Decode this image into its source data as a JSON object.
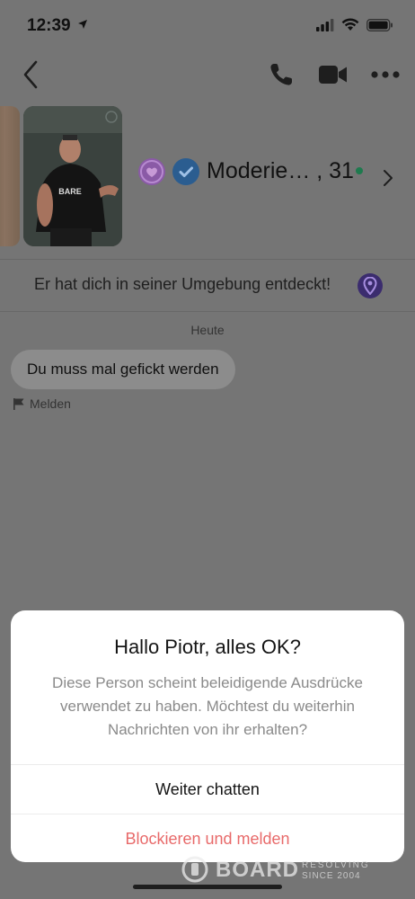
{
  "status_bar": {
    "time": "12:39"
  },
  "profile": {
    "name_age": "Moderie… , 31",
    "photo_text": "BARE"
  },
  "discover_banner": {
    "text": "Er hat dich in seiner Umgebung entdeckt!"
  },
  "chat": {
    "date_label": "Heute",
    "messages": [
      {
        "text": "Du muss mal gefickt werden"
      }
    ],
    "report_label": "Melden"
  },
  "dialog": {
    "title": "Hallo Piotr, alles OK?",
    "body_lines": [
      "Diese Person scheint beleidigende Ausdrücke",
      "verwendet zu haben. Möchtest du weiterhin",
      "Nachrichten von ihr erhalten?"
    ],
    "continue_button": "Weiter chatten",
    "block_button": "Blockieren und melden"
  },
  "watermark": {
    "brand": "BOARD",
    "line1": "RESOLVING",
    "line2": "SINCE 2004"
  },
  "colors": {
    "overlay_bg": "#757575",
    "dialog_bg": "#ffffff",
    "danger": "#e86a6a",
    "online": "#1e7a4e"
  },
  "icons": {
    "status": [
      "location-arrow-icon",
      "signal-icon",
      "wifi-icon",
      "battery-icon"
    ],
    "nav": [
      "back-chevron-icon",
      "phone-icon",
      "video-camera-icon",
      "more-icon"
    ],
    "profile": [
      "heart-badge-icon",
      "verified-check-icon",
      "chevron-right-icon"
    ],
    "misc": [
      "location-pin-icon",
      "flag-icon"
    ]
  }
}
